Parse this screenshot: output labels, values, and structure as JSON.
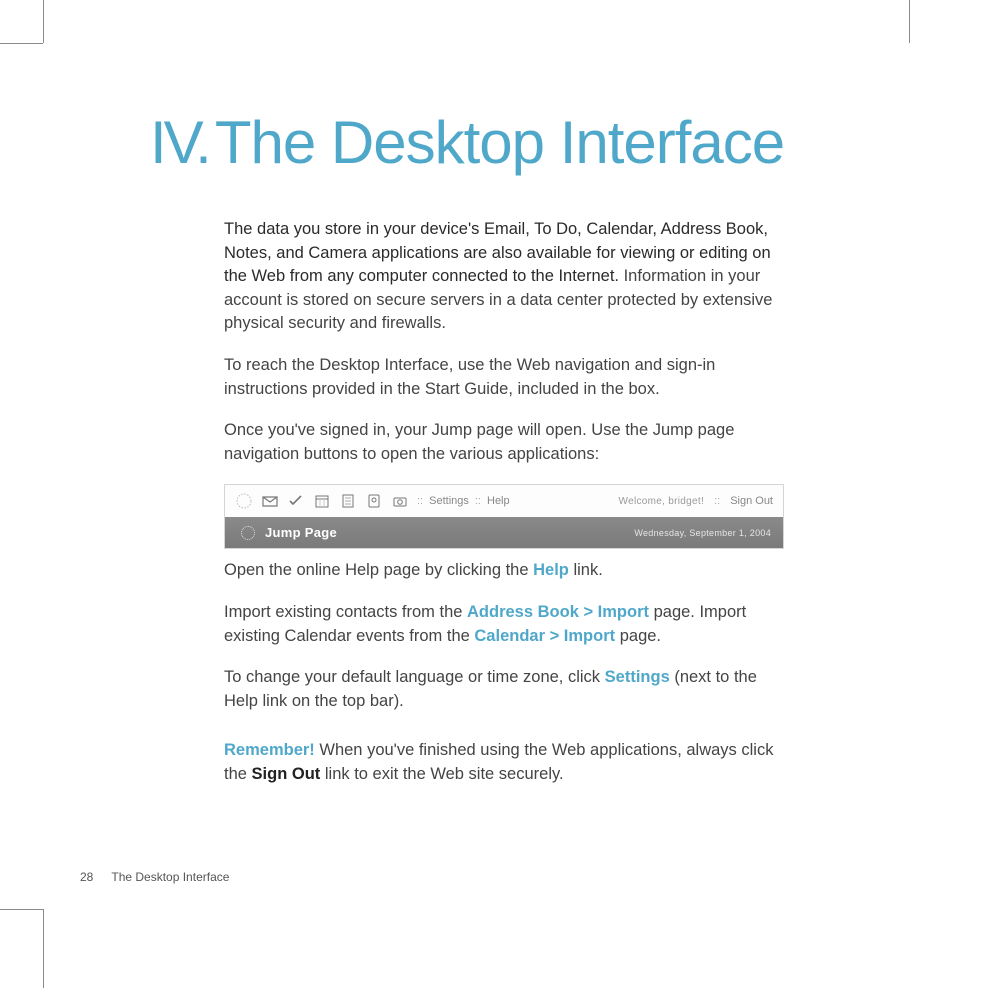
{
  "chapter": {
    "number": "IV.",
    "title": "The Desktop Interface"
  },
  "paragraphs": {
    "p1_lead": "The data you store in your device's Email, To Do, Calendar, Address Book, Notes, and Camera applications are also available for viewing or editing on the Web from any computer connected to the Internet.",
    "p1_rest": " Information in your account is stored on secure servers in a data center protected by extensive physical security and firewalls.",
    "p2": "To reach the Desktop Interface, use the Web navigation and sign-in instructions provided in the Start Guide, included in the box.",
    "p3": "Once you've signed in, your Jump page will open. Use the Jump page navigation buttons to open the various applications:",
    "p4_a": "Open the online Help page by clicking the ",
    "p4_link": "Help",
    "p4_b": " link.",
    "p5_a": "Import existing contacts from the ",
    "p5_link1": "Address Book > Import",
    "p5_b": " page. Import existing Calendar events from the ",
    "p5_link2": "Calendar > Import",
    "p5_c": " page.",
    "p6_a": "To change your default language or time zone, click ",
    "p6_link": "Settings",
    "p6_b": " (next to the Help link on the top bar).",
    "p7_remember": "Remember!",
    "p7_a": "  When you've finished using the Web applications, always click the ",
    "p7_bold": "Sign Out",
    "p7_b": " link to exit the Web site securely."
  },
  "toolbar": {
    "settings_label": "Settings",
    "help_label": "Help",
    "welcome": "Welcome, bridget!",
    "sign_out": "Sign Out",
    "sep": "::",
    "jump_title": "Jump Page",
    "jump_date": "Wednesday, September 1, 2004"
  },
  "footer": {
    "page_number": "28",
    "section": "The Desktop Interface"
  }
}
